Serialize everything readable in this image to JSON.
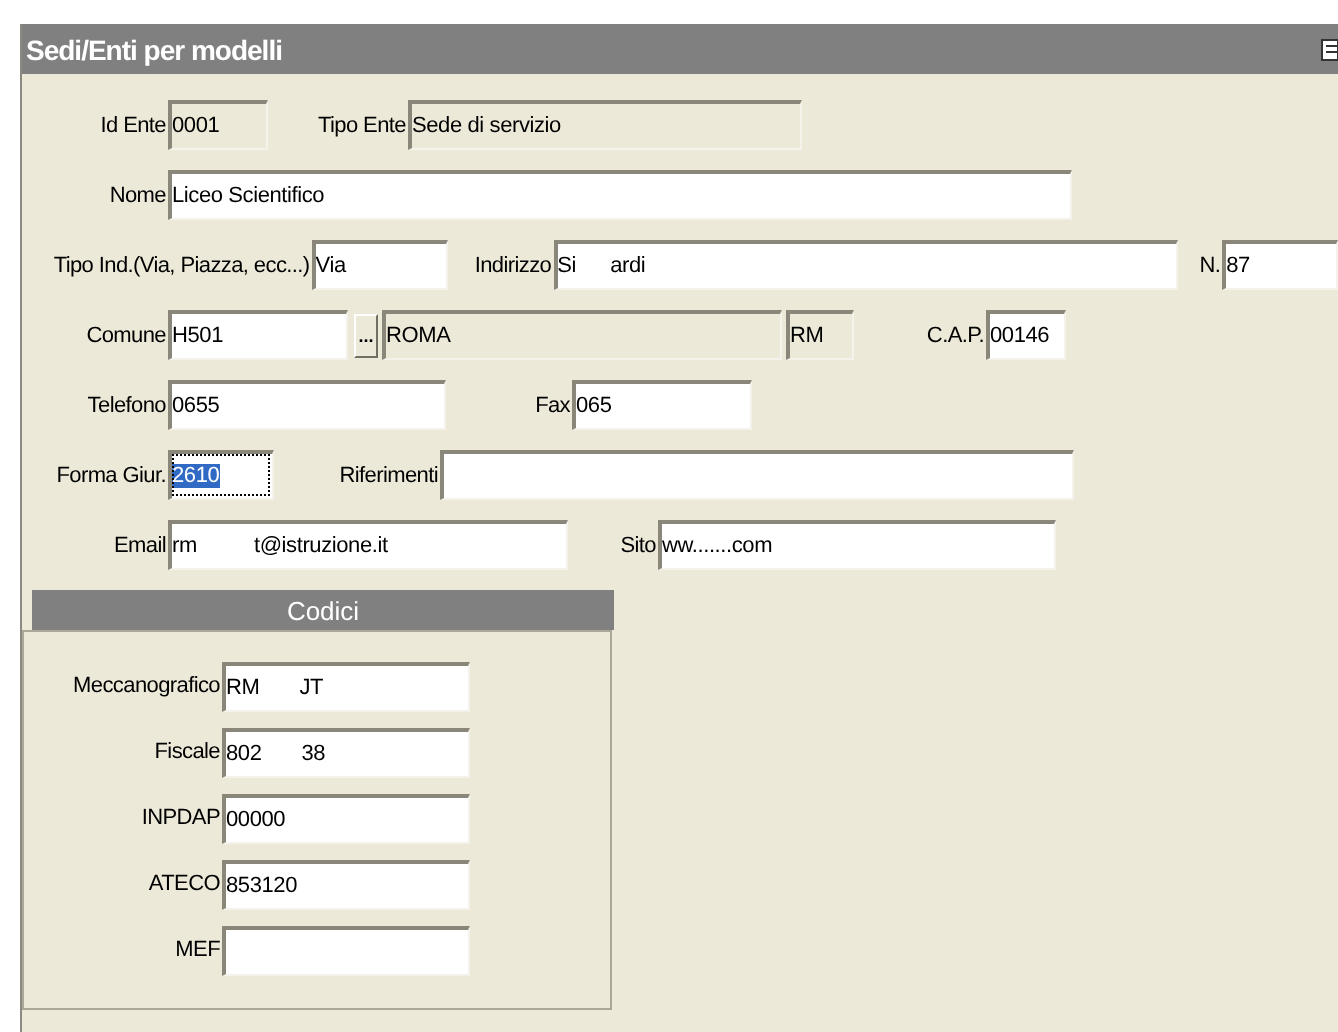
{
  "window": {
    "title": "Sedi/Enti per modelli"
  },
  "rows": [
    [
      {
        "label": "Id Ente",
        "value": "0001",
        "kind": "readonly",
        "focused": false
      },
      {
        "label": "Tipo Ente",
        "value": "Sede di servizio",
        "kind": "readonly",
        "focused": false
      }
    ],
    [
      {
        "label": "Nome",
        "value": "Liceo Scientifico",
        "kind": "text",
        "focused": false
      }
    ],
    [
      {
        "label": "Tipo Ind.(Via, Piazza, ecc...)",
        "value": "Via",
        "kind": "text",
        "focused": false
      },
      {
        "label": "Indirizzo",
        "value": "Si      ardi",
        "kind": "text",
        "focused": false
      },
      {
        "label": "N.",
        "value": "87",
        "kind": "text",
        "focused": false
      }
    ],
    [
      {
        "label": "Comune",
        "value": "H501",
        "kind": "text",
        "focused": false
      },
      {
        "kind": "button",
        "text": "..."
      },
      {
        "value": "ROMA",
        "kind": "readonly",
        "focused": false
      },
      {
        "value": "RM",
        "kind": "readonly",
        "focused": false
      },
      {
        "label": "C.A.P.",
        "value": "00146",
        "kind": "text",
        "focused": false
      }
    ],
    [
      {
        "label": "Telefono",
        "value": "0655",
        "kind": "text",
        "focused": false
      },
      {
        "label": "Fax",
        "value": "065",
        "kind": "text",
        "focused": false
      }
    ],
    [
      {
        "label": "Forma Giur.",
        "value": "2610",
        "kind": "text",
        "focused": true
      },
      {
        "label": "Riferimenti",
        "kind": "text",
        "focused": false
      }
    ],
    [
      {
        "label": "Email",
        "value": "rm          t@istruzione.it",
        "kind": "text",
        "focused": false
      },
      {
        "label": "Sito",
        "value": "ww.......com",
        "kind": "text",
        "focused": false
      }
    ]
  ],
  "codici": {
    "title": "Codici",
    "fields": [
      {
        "label": "Meccanografico",
        "value": "RM       JT"
      },
      {
        "label": "Fiscale",
        "value": "802       38"
      },
      {
        "label": "INPDAP",
        "value": "00000"
      },
      {
        "label": "ATECO",
        "value": "853120"
      },
      {
        "label": "MEF"
      }
    ]
  }
}
